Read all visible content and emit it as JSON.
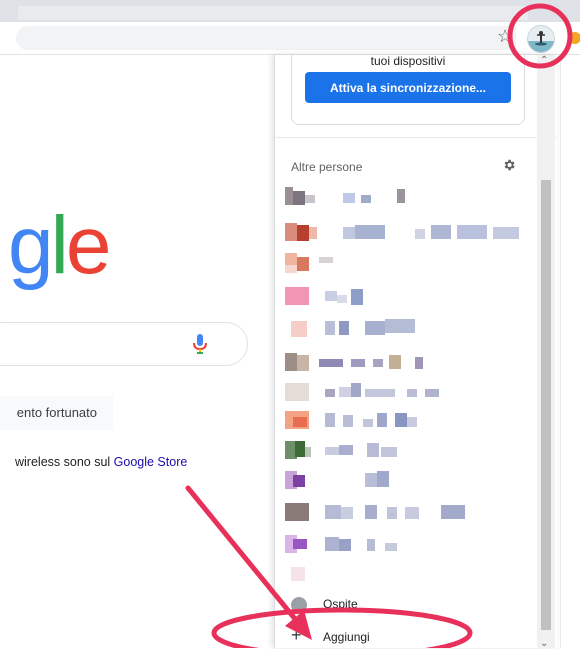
{
  "colors": {
    "google_blue": "#4285f4",
    "google_red": "#ea4335",
    "google_green": "#34a853",
    "sync_button": "#1a73e8",
    "annotation": "#e8315a"
  },
  "browser": {
    "star_icon": "☆",
    "profile_icon": "profile-avatar"
  },
  "google_page": {
    "logo_partial": [
      "g",
      "l",
      "e"
    ],
    "lucky_button_partial": "ento fortunato",
    "promo_text_partial": "wireless sono sul ",
    "promo_link": "Google Store"
  },
  "profile_menu": {
    "sync_text_partial": "tuoi dispositivi",
    "sync_button": "Attiva la sincronizzazione...",
    "other_people_heading": "Altre persone",
    "guest_label": "Ospite",
    "add_label": "Aggiungi",
    "add_icon": "+"
  }
}
